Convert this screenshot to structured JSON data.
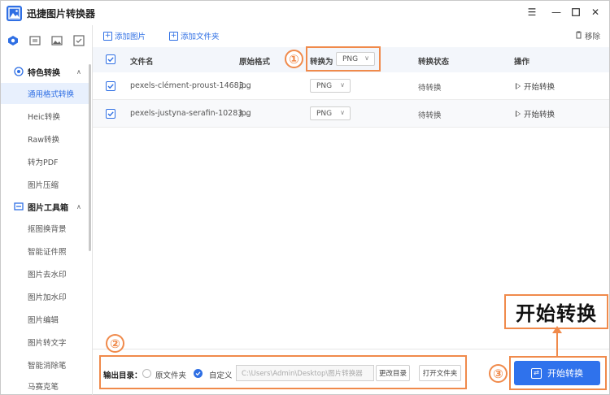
{
  "app": {
    "title": "迅捷图片转换器",
    "accent": "#2f6fe4",
    "annotation_color": "#f08a4b"
  },
  "window_controls": [
    "menu-icon",
    "minimize-icon",
    "maximize-icon",
    "close-icon"
  ],
  "sidebar": {
    "groups": [
      {
        "label": "特色转换",
        "icon": "star-icon",
        "items": [
          {
            "label": "通用格式转换",
            "active": true
          },
          {
            "label": "Heic转换"
          },
          {
            "label": "Raw转换"
          },
          {
            "label": "转为PDF"
          },
          {
            "label": "图片压缩"
          }
        ]
      },
      {
        "label": "图片工具箱",
        "icon": "toolbox-icon",
        "items": [
          {
            "label": "抠图换背景"
          },
          {
            "label": "智能证件照"
          },
          {
            "label": "图片去水印"
          },
          {
            "label": "图片加水印"
          },
          {
            "label": "图片编辑"
          },
          {
            "label": "图片转文字"
          },
          {
            "label": "智能消除笔"
          },
          {
            "label": "马赛克笔"
          }
        ]
      }
    ]
  },
  "toolbar": {
    "add_image": "添加图片",
    "add_folder": "添加文件夹",
    "remove": "移除"
  },
  "table": {
    "headers": {
      "filename": "文件名",
      "original_format": "原始格式",
      "convert_to": "转换为",
      "status": "转换状态",
      "action": "操作"
    },
    "global_format": "PNG",
    "rows": [
      {
        "filename": "pexels-clément-proust-14683...",
        "format": "jpg",
        "target": "PNG",
        "status": "待转换",
        "action": "开始转换"
      },
      {
        "filename": "pexels-justyna-serafin-10283...",
        "format": "jpg",
        "target": "PNG",
        "status": "待转换",
        "action": "开始转换"
      }
    ]
  },
  "output": {
    "label": "输出目录：",
    "option_original": "原文件夹",
    "option_custom": "自定义",
    "path": "C:\\Users\\Admin\\Desktop\\图片转换器",
    "change_dir": "更改目录",
    "open_folder": "打开文件夹"
  },
  "start_button": "开始转换",
  "annotations": {
    "step1": "①",
    "step2": "②",
    "step3": "③",
    "callout": "开始转换"
  }
}
